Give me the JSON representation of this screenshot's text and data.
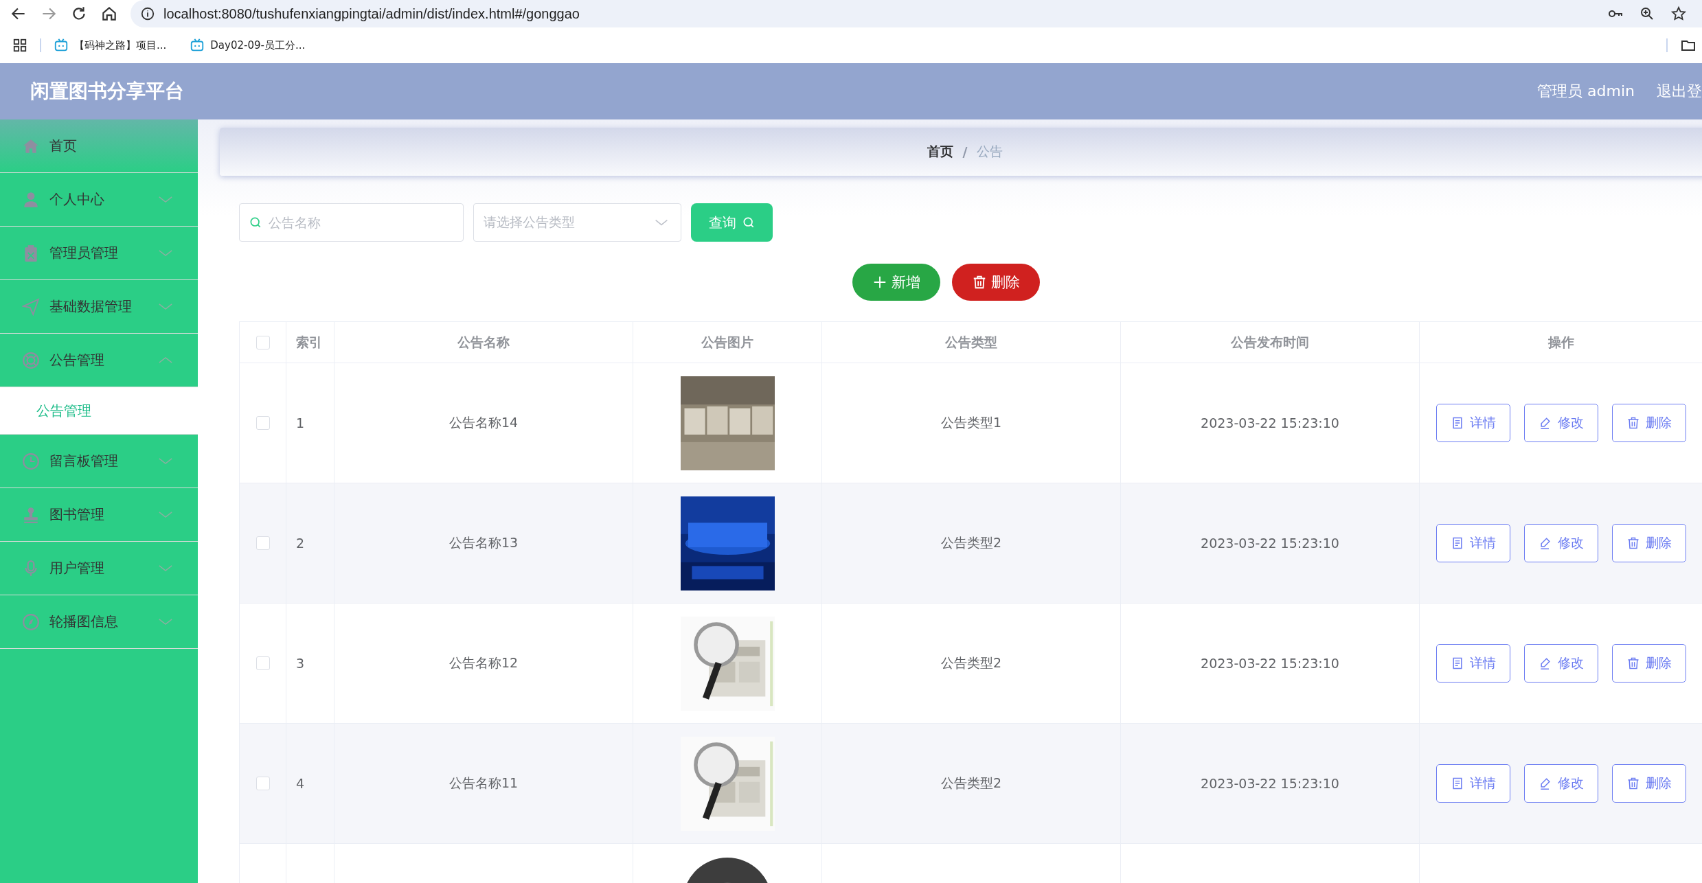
{
  "browser": {
    "url": "localhost:8080/tushufenxiangpingtai/admin/dist/index.html#/gonggao",
    "bookmarks": [
      "【码神之路】项目...",
      "Day02-09-员工分..."
    ]
  },
  "header": {
    "title": "闲置图书分享平台",
    "user": "管理员 admin",
    "logout": "退出登"
  },
  "sidebar": {
    "items": [
      {
        "label": "首页",
        "selected": false
      },
      {
        "label": "个人中心",
        "selected": false,
        "expanded": false
      },
      {
        "label": "管理员管理",
        "selected": false,
        "expanded": false
      },
      {
        "label": "基础数据管理",
        "selected": false,
        "expanded": false
      },
      {
        "label": "公告管理",
        "selected": false,
        "expanded": true,
        "children": [
          {
            "label": "公告管理",
            "selected": true
          }
        ]
      },
      {
        "label": "留言板管理",
        "selected": false,
        "expanded": false
      },
      {
        "label": "图书管理",
        "selected": false,
        "expanded": false
      },
      {
        "label": "用户管理",
        "selected": false,
        "expanded": false
      },
      {
        "label": "轮播图信息",
        "selected": false,
        "expanded": false
      }
    ]
  },
  "breadcrumb": {
    "separator": "/",
    "items": [
      {
        "label": "首页",
        "current": false
      },
      {
        "label": "公告",
        "current": true
      }
    ]
  },
  "search": {
    "name_placeholder": "公告名称",
    "type_placeholder": "请选择公告类型",
    "button": "查询"
  },
  "actions": [
    {
      "label": "新增",
      "kind": "add"
    },
    {
      "label": "删除",
      "kind": "delete"
    }
  ],
  "table": {
    "select_all_checked": false,
    "columns": [
      "索引",
      "公告名称",
      "公告图片",
      "公告类型",
      "公告发布时间",
      "操作"
    ],
    "rows": [
      {
        "kind": "full",
        "checked": false,
        "index": "1",
        "name": "公告名称14",
        "type": "公告类型1",
        "time": "2023-03-22 15:23:10",
        "actions": [
          {
            "label": "详情",
            "kind": "detail"
          },
          {
            "label": "修改",
            "kind": "edit"
          },
          {
            "label": "删除",
            "kind": "delete"
          }
        ]
      },
      {
        "kind": "full",
        "checked": false,
        "index": "2",
        "name": "公告名称13",
        "type": "公告类型2",
        "time": "2023-03-22 15:23:10",
        "actions": [
          {
            "label": "详情",
            "kind": "detail"
          },
          {
            "label": "修改",
            "kind": "edit"
          },
          {
            "label": "删除",
            "kind": "delete"
          }
        ]
      },
      {
        "kind": "full",
        "checked": false,
        "index": "3",
        "name": "公告名称12",
        "type": "公告类型2",
        "time": "2023-03-22 15:23:10",
        "actions": [
          {
            "label": "详情",
            "kind": "detail"
          },
          {
            "label": "修改",
            "kind": "edit"
          },
          {
            "label": "删除",
            "kind": "delete"
          }
        ]
      },
      {
        "kind": "full",
        "checked": false,
        "index": "4",
        "name": "公告名称11",
        "type": "公告类型2",
        "time": "2023-03-22 15:23:10",
        "actions": [
          {
            "label": "详情",
            "kind": "detail"
          },
          {
            "label": "修改",
            "kind": "edit"
          },
          {
            "label": "删除",
            "kind": "delete"
          }
        ]
      },
      {
        "kind": "partial"
      }
    ]
  }
}
